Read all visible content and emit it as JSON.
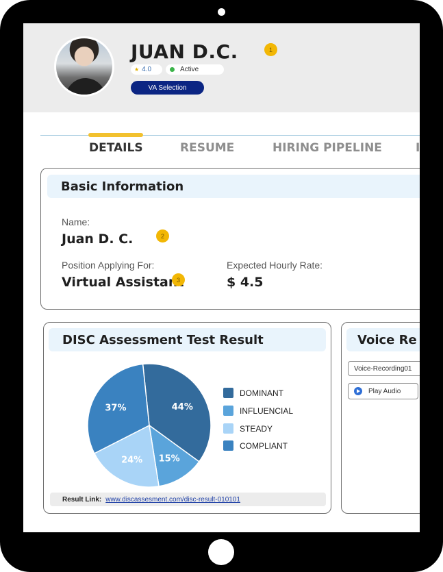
{
  "profile": {
    "name": "JUAN D.C.",
    "rating": "4.0",
    "status": "Active",
    "button_label": "VA Selection"
  },
  "markers": [
    "1",
    "2",
    "3"
  ],
  "tabs": [
    {
      "label": "DETAILS",
      "active": true
    },
    {
      "label": "RESUME",
      "active": false
    },
    {
      "label": "HIRING PIPELINE",
      "active": false
    }
  ],
  "basic_info": {
    "title": "Basic Information",
    "name_label": "Name:",
    "name_value": "Juan D. C.",
    "position_label": "Position Applying For:",
    "position_value": "Virtual Assistant",
    "rate_label": "Expected Hourly Rate:",
    "rate_value": "$ 4.5"
  },
  "disc": {
    "title": "DISC Assessment Test Result",
    "result_link_label": "Result Link:",
    "result_link": "www.discassesment.com/disc-result-010101"
  },
  "voice": {
    "title": "Voice Re",
    "file_name": "Voice-Recording01",
    "play_label": "Play Audio"
  },
  "chart_data": {
    "type": "pie",
    "categories": [
      "DOMINANT",
      "INFLUENCIAL",
      "STEADY",
      "COMPLIANT"
    ],
    "values": [
      44,
      15,
      24,
      37
    ],
    "labels": [
      "44%",
      "15%",
      "24%",
      "37%"
    ],
    "colors": [
      "#336b9c",
      "#5aa4db",
      "#a9d4f7",
      "#3a82c0"
    ],
    "legend_position": "right"
  }
}
